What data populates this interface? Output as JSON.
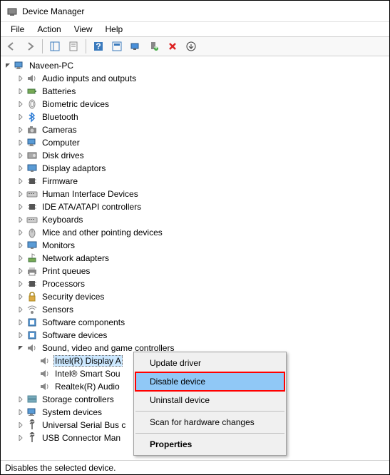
{
  "title": "Device Manager",
  "menu": {
    "file": "File",
    "action": "Action",
    "view": "View",
    "help": "Help"
  },
  "tree": {
    "root": "Naveen-PC",
    "categories": [
      "Audio inputs and outputs",
      "Batteries",
      "Biometric devices",
      "Bluetooth",
      "Cameras",
      "Computer",
      "Disk drives",
      "Display adaptors",
      "Firmware",
      "Human Interface Devices",
      "IDE ATA/ATAPI controllers",
      "Keyboards",
      "Mice and other pointing devices",
      "Monitors",
      "Network adapters",
      "Print queues",
      "Processors",
      "Security devices",
      "Sensors",
      "Software components",
      "Software devices"
    ],
    "expanded": {
      "label": "Sound, video and game controllers",
      "children": [
        "Intel(R) Display A",
        "Intel® Smart Sou",
        "Realtek(R) Audio"
      ]
    },
    "after": [
      "Storage controllers",
      "System devices",
      "Universal Serial Bus c",
      "USB Connector Man"
    ]
  },
  "context": {
    "update": "Update driver",
    "disable": "Disable device",
    "uninstall": "Uninstall device",
    "scan": "Scan for hardware changes",
    "properties": "Properties"
  },
  "status": "Disables the selected device."
}
